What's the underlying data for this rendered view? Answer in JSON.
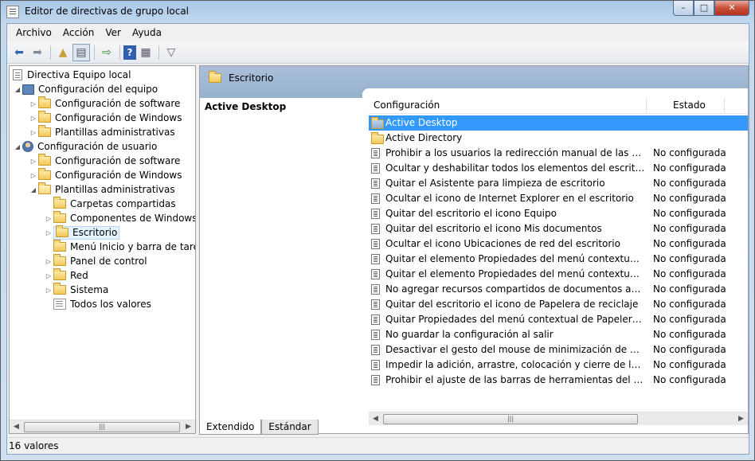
{
  "window": {
    "title": "Editor de directivas de grupo local"
  },
  "menu": [
    "Archivo",
    "Acción",
    "Ver",
    "Ayuda"
  ],
  "toolbar": {
    "icons": [
      "back-arrow-icon",
      "forward-arrow-icon",
      "up-folder-icon",
      "show-hide-tree-icon",
      "export-list-icon",
      "help-icon",
      "properties-icon",
      "filter-icon"
    ]
  },
  "tree": {
    "root": "Directiva Equipo local",
    "computer": "Configuración del equipo",
    "computer_children": [
      "Configuración de software",
      "Configuración de Windows",
      "Plantillas administrativas"
    ],
    "user": "Configuración de usuario",
    "user_children": [
      "Configuración de software",
      "Configuración de Windows",
      "Plantillas administrativas"
    ],
    "admin_children": [
      "Carpetas compartidas",
      "Componentes de Windows",
      "Escritorio",
      "Menú Inicio y barra de tareas",
      "Panel de control",
      "Red",
      "Sistema",
      "Todos los valores"
    ]
  },
  "right": {
    "header_title": "Escritorio",
    "detail_title": "Active Desktop",
    "columns": {
      "setting": "Configuración",
      "state": "Estado"
    },
    "rows": [
      {
        "label": "Active Desktop",
        "state": "",
        "type": "folder"
      },
      {
        "label": "Active Directory",
        "state": "",
        "type": "folder"
      },
      {
        "label": "Prohibir a los usuarios la redirección manual de las carpetas ...",
        "state": "No configurada",
        "type": "setting"
      },
      {
        "label": "Ocultar y deshabilitar todos los elementos del escritorio",
        "state": "No configurada",
        "type": "setting"
      },
      {
        "label": "Quitar el Asistente para limpieza de escritorio",
        "state": "No configurada",
        "type": "setting"
      },
      {
        "label": "Ocultar el icono de Internet Explorer en el escritorio",
        "state": "No configurada",
        "type": "setting"
      },
      {
        "label": "Quitar del escritorio el icono Equipo",
        "state": "No configurada",
        "type": "setting"
      },
      {
        "label": "Quitar del escritorio el icono Mis documentos",
        "state": "No configurada",
        "type": "setting"
      },
      {
        "label": "Ocultar el icono Ubicaciones de red del escritorio",
        "state": "No configurada",
        "type": "setting"
      },
      {
        "label": "Quitar el elemento Propiedades del menú contextual del ico...",
        "state": "No configurada",
        "type": "setting"
      },
      {
        "label": "Quitar el elemento Propiedades del menú contextual del ico...",
        "state": "No configurada",
        "type": "setting"
      },
      {
        "label": "No agregar recursos compartidos de documentos abiertos r...",
        "state": "No configurada",
        "type": "setting"
      },
      {
        "label": "Quitar del escritorio el icono de Papelera de reciclaje",
        "state": "No configurada",
        "type": "setting"
      },
      {
        "label": "Quitar Propiedades del menú contextual de Papelera de reci...",
        "state": "No configurada",
        "type": "setting"
      },
      {
        "label": "No guardar la configuración al salir",
        "state": "No configurada",
        "type": "setting"
      },
      {
        "label": "Desactivar el gesto del mouse de minimización de ventanas",
        "state": "No configurada",
        "type": "setting"
      },
      {
        "label": "Impedir la adición, arrastre, colocación y cierre de las barras ...",
        "state": "No configurada",
        "type": "setting"
      },
      {
        "label": "Prohibir el ajuste de las barras de herramientas del escritorio",
        "state": "No configurada",
        "type": "setting"
      }
    ]
  },
  "tabs": [
    "Extendido",
    "Estándar"
  ],
  "status": "16 valores"
}
